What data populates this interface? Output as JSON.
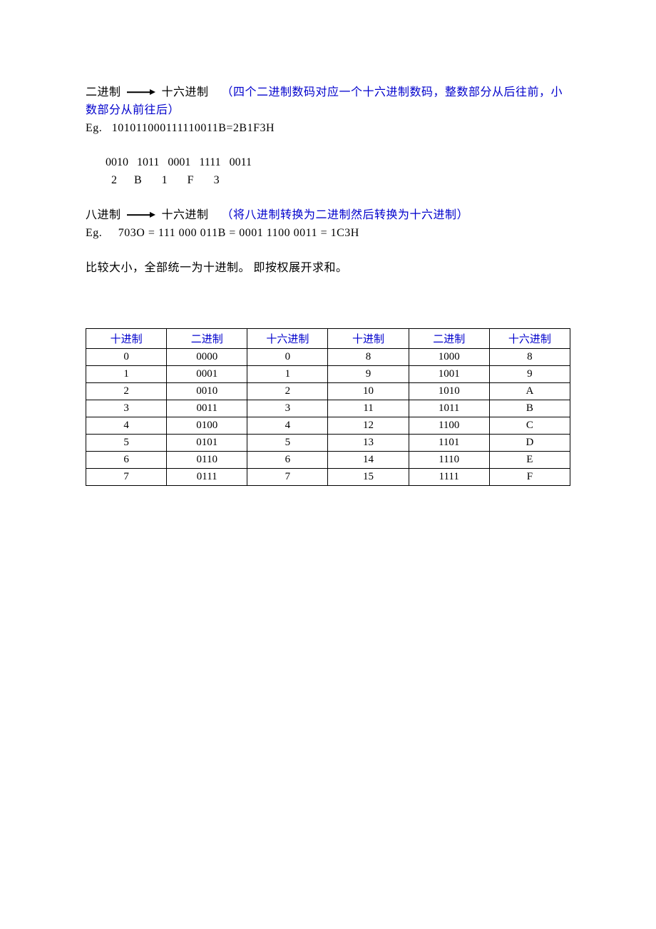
{
  "section1": {
    "from": "二进制",
    "to": "十六进制",
    "note_open": "（",
    "note": "四个二进制数码对应一个十六进制数码，整数部分从后往前，小数部分从前往后",
    "note_close": "）",
    "eg_label": "Eg.",
    "eg_expr": "101011000111110011B=2B1F3H",
    "bin_row": "0010   1011   0001   1111   0011",
    "hex_row": "  2      B       1       F       3"
  },
  "section2": {
    "from": "八进制",
    "to": "十六进制",
    "note_open": "（",
    "note": "将八进制转换为二进制然后转换为十六进制",
    "note_close": "）",
    "eg_label": "Eg.",
    "eg_expr": "703O = 111   000   011B = 0001   1100   0011 = 1C3H"
  },
  "section3": {
    "text": "比较大小，全部统一为十进制。 即按权展开求和。"
  },
  "table": {
    "headers": [
      "十进制",
      "二进制",
      "十六进制",
      "十进制",
      "二进制",
      "十六进制"
    ],
    "rows": [
      [
        "0",
        "0000",
        "0",
        "8",
        "1000",
        "8"
      ],
      [
        "1",
        "0001",
        "1",
        "9",
        "1001",
        "9"
      ],
      [
        "2",
        "0010",
        "2",
        "10",
        "1010",
        "A"
      ],
      [
        "3",
        "0011",
        "3",
        "11",
        "1011",
        "B"
      ],
      [
        "4",
        "0100",
        "4",
        "12",
        "1100",
        "C"
      ],
      [
        "5",
        "0101",
        "5",
        "13",
        "1101",
        "D"
      ],
      [
        "6",
        "0110",
        "6",
        "14",
        "1110",
        "E"
      ],
      [
        "7",
        "0111",
        "7",
        "15",
        "1111",
        "F"
      ]
    ]
  }
}
